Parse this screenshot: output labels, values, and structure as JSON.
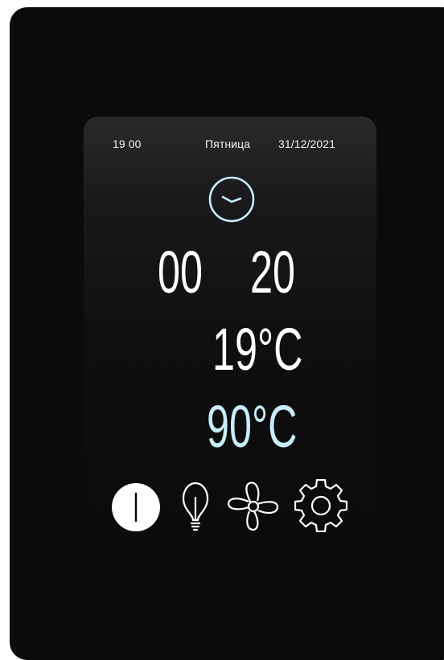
{
  "status": {
    "time": "19 00",
    "day": "Пятница",
    "date": "31/12/2021"
  },
  "timer": {
    "hours": "00",
    "minutes": "20"
  },
  "temperature": {
    "current": "19°C",
    "target": "90°C"
  },
  "colors": {
    "accent": "#c8ecf8",
    "text": "#ffffff",
    "bezel": "#0b0b0b"
  },
  "icons": [
    "clock-icon",
    "power-icon",
    "light-bulb-icon",
    "fan-icon",
    "gear-icon"
  ]
}
